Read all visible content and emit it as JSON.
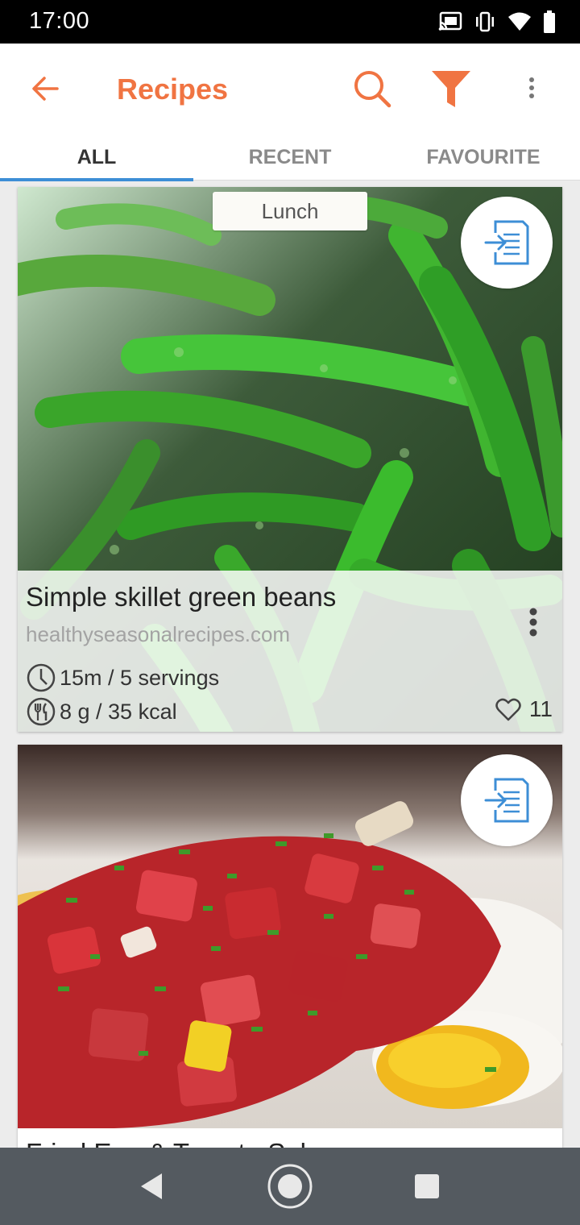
{
  "status_bar": {
    "time": "17:00",
    "icons": [
      "cast-icon",
      "vibrate-icon",
      "wifi-icon",
      "battery-icon"
    ]
  },
  "app_bar": {
    "title": "Recipes",
    "accent_color": "#f07442",
    "icons": [
      "back-arrow-icon",
      "search-icon",
      "filter-icon",
      "more-vert-icon"
    ]
  },
  "tabs": [
    {
      "label": "ALL",
      "active": true
    },
    {
      "label": "RECENT",
      "active": false
    },
    {
      "label": "FAVOURITE",
      "active": false
    }
  ],
  "recipes": [
    {
      "meal_type": "Lunch",
      "title": "Simple skillet green beans",
      "source": "healthyseasonalrecipes.com",
      "time_servings": "15m / 5 servings",
      "nutrition": "8 g / 35 kcal",
      "likes": "11",
      "image": "green-beans-photo"
    },
    {
      "title": "Fried Egg & Tomato Salsa",
      "image": "tomato-egg-photo"
    }
  ],
  "nav_bar": {
    "icons": [
      "nav-back-icon",
      "nav-home-icon",
      "nav-recents-icon"
    ]
  }
}
